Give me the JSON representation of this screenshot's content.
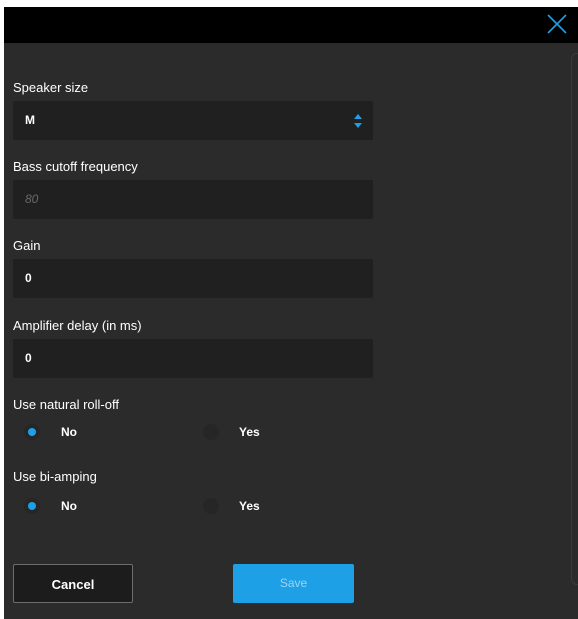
{
  "dialog": {
    "close_icon": "close-icon",
    "fields": {
      "speaker_size": {
        "label": "Speaker size",
        "value": "M"
      },
      "bass_cutoff": {
        "label": "Bass cutoff frequency",
        "placeholder": "80"
      },
      "gain": {
        "label": "Gain",
        "value": "0"
      },
      "amp_delay": {
        "label": "Amplifier delay (in ms)",
        "value": "0"
      }
    },
    "natural_rolloff": {
      "label": "Use natural roll-off",
      "option_no": "No",
      "option_yes": "Yes",
      "selected": "No"
    },
    "bi_amping": {
      "label": "Use bi-amping",
      "option_no": "No",
      "option_yes": "Yes",
      "selected": "No"
    },
    "buttons": {
      "cancel": "Cancel",
      "save": "Save"
    },
    "colors": {
      "accent": "#1ea0e6",
      "background": "#2b2b2b",
      "field_bg": "#202020",
      "titlebar": "#000000"
    }
  }
}
